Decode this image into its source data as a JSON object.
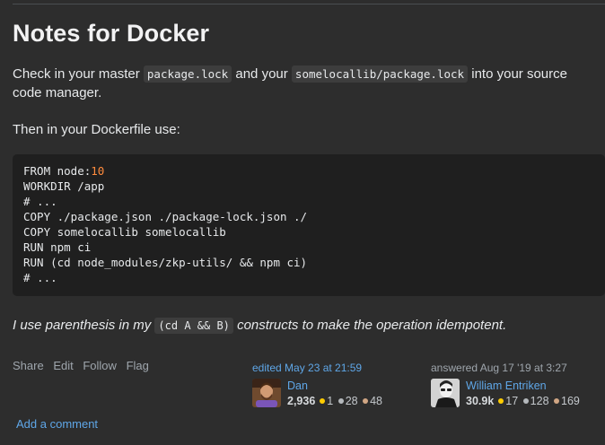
{
  "heading": "Notes for Docker",
  "para1": {
    "t1": "Check in your master ",
    "c1": "package.lock",
    "t2": " and your ",
    "c2": "somelocallib/package.lock",
    "t3": " into your source code manager."
  },
  "para2": "Then in your Dockerfile use:",
  "code": {
    "l1a": "FROM node:",
    "l1b": "10",
    "l2": "WORKDIR /app",
    "l3": "# ...",
    "l4": "COPY ./package.json ./package-lock.json ./",
    "l5": "COPY somelocallib somelocallib",
    "l6": "RUN npm ci",
    "l7": "RUN (cd node_modules/zkp-utils/ && npm ci)",
    "l8": "# ..."
  },
  "para3": {
    "t1": "I use parenthesis in my ",
    "c1": "(cd A && B)",
    "t2": " constructs to make the operation idempotent."
  },
  "actions": [
    "Share",
    "Edit",
    "Follow",
    "Flag"
  ],
  "editor": {
    "label": "edited May 23 at 21:59",
    "name": "Dan",
    "rep": "2,936",
    "gold": "1",
    "silver": "28",
    "bronze": "48"
  },
  "author": {
    "label": "answered Aug 17 '19 at 3:27",
    "name": "William Entriken",
    "rep": "30.9k",
    "gold": "17",
    "silver": "128",
    "bronze": "169"
  },
  "add_comment": "Add a comment",
  "colors": {
    "link": "#5fa7e8",
    "code_number": "#ff8b3d",
    "background": "#2d2d2d"
  }
}
